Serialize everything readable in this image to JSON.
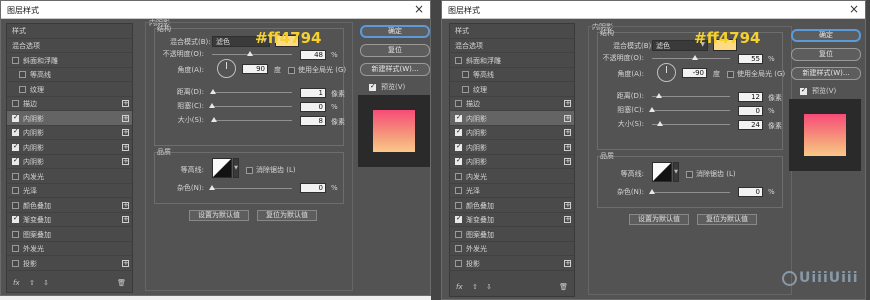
{
  "dialog": {
    "title": "图层样式",
    "close_icon": "close-icon"
  },
  "hex_label": "#ff4794",
  "left_panel": {
    "header": "样式",
    "rows": [
      {
        "label": "混合选项",
        "checkbox": null,
        "plus": false,
        "sel": false,
        "indent": 0
      },
      {
        "label": "斜面和浮雕",
        "checkbox": false,
        "plus": false,
        "sel": false,
        "indent": 0
      },
      {
        "label": "等高线",
        "checkbox": false,
        "plus": false,
        "sel": false,
        "indent": 1
      },
      {
        "label": "纹理",
        "checkbox": false,
        "plus": false,
        "sel": false,
        "indent": 1
      },
      {
        "label": "描边",
        "checkbox": false,
        "plus": true,
        "sel": false,
        "indent": 0
      },
      {
        "label": "内阴影",
        "checkbox": true,
        "plus": true,
        "sel": true,
        "indent": 0
      },
      {
        "label": "内阴影",
        "checkbox": true,
        "plus": true,
        "sel": false,
        "indent": 0
      },
      {
        "label": "内阴影",
        "checkbox": true,
        "plus": true,
        "sel": false,
        "indent": 0
      },
      {
        "label": "内阴影",
        "checkbox": true,
        "plus": true,
        "sel": false,
        "indent": 0
      },
      {
        "label": "内发光",
        "checkbox": false,
        "plus": false,
        "sel": false,
        "indent": 0
      },
      {
        "label": "光泽",
        "checkbox": false,
        "plus": false,
        "sel": false,
        "indent": 0
      },
      {
        "label": "颜色叠加",
        "checkbox": false,
        "plus": true,
        "sel": false,
        "indent": 0
      },
      {
        "label": "渐变叠加",
        "checkbox": true,
        "plus": true,
        "sel": false,
        "indent": 0
      },
      {
        "label": "图案叠加",
        "checkbox": false,
        "plus": false,
        "sel": false,
        "indent": 0
      },
      {
        "label": "外发光",
        "checkbox": false,
        "plus": false,
        "sel": false,
        "indent": 0
      },
      {
        "label": "投影",
        "checkbox": false,
        "plus": true,
        "sel": false,
        "indent": 0
      }
    ],
    "footer": {
      "fx": "fx",
      "up": "⇧",
      "down": "⇩",
      "trash": "🗑"
    }
  },
  "inner_shadow": {
    "title": "内阴影",
    "structure": {
      "title": "结构",
      "blend_mode_label": "混合模式(B):",
      "blend_mode_value": "滤色",
      "swatch_color": "#fddb84",
      "opacity_label": "不透明度(O):",
      "angle_label": "角度(A):",
      "degree_unit": "度",
      "global_light_label": "使用全局光 (G)",
      "distance_label": "距离(D):",
      "choke_label": "阻塞(C):",
      "size_label": "大小(S):",
      "px_unit": "像素",
      "pct_unit": "%"
    },
    "quality": {
      "title": "品质",
      "contour_label": "等高线:",
      "antialias_label": "消除锯齿 (L)",
      "noise_label": "杂色(N):",
      "noise_value": "0"
    },
    "default_btn": "设置为默认值",
    "reset_btn": "复位为默认值"
  },
  "right_buttons": {
    "ok": "确定",
    "reset": "复位",
    "new_style": "新建样式(W)...",
    "preview": "预览(V)"
  },
  "dlg1_values": {
    "opacity": "48",
    "opacity_frac": 0.48,
    "angle": "90",
    "distance": "1",
    "choke": "0",
    "size": "8",
    "distance_frac": 0.01,
    "choke_frac": 0.0,
    "size_frac": 0.03
  },
  "dlg2_values": {
    "opacity": "55",
    "opacity_frac": 0.55,
    "angle": "-90",
    "distance": "12",
    "choke": "0",
    "size": "24",
    "distance_frac": 0.09,
    "choke_frac": 0.0,
    "size_frac": 0.1
  },
  "logo": "UiiiUiii"
}
